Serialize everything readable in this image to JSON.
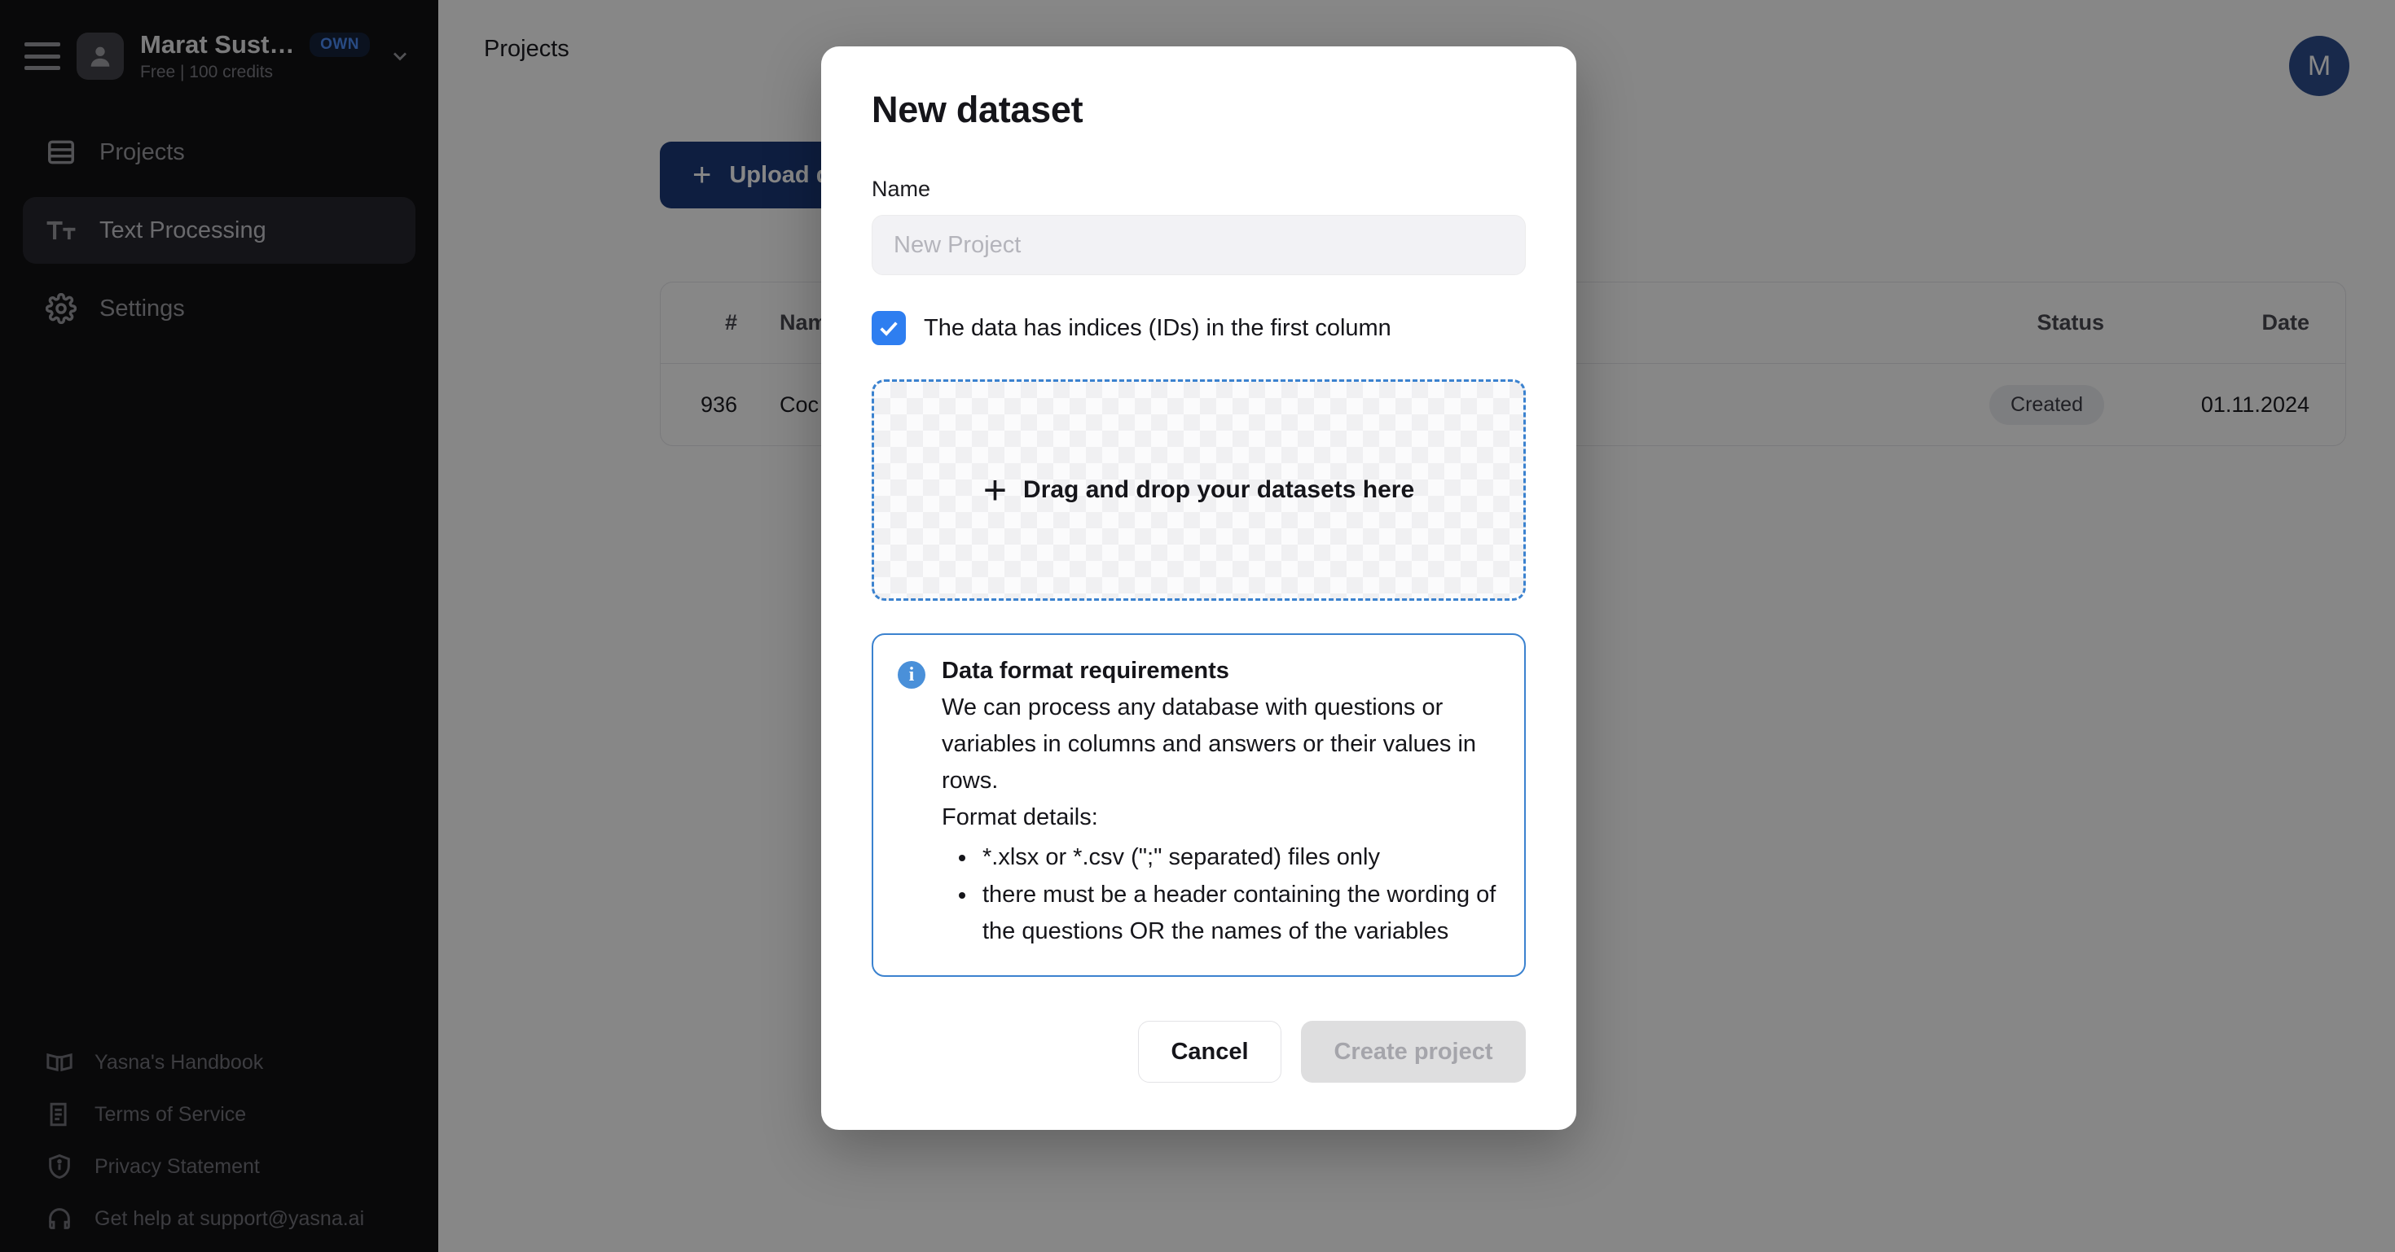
{
  "sidebar": {
    "account": {
      "name": "Marat Sustav...",
      "badge": "OWN",
      "subtitle": "Free | 100 credits",
      "menu_icon": "hamburger-icon",
      "avatar_icon": "person-icon",
      "chevron_icon": "chevron-down-icon"
    },
    "nav": [
      {
        "label": "Projects",
        "icon": "table-rows-icon",
        "active": false
      },
      {
        "label": "Text Processing",
        "icon": "text-format-icon",
        "active": true
      },
      {
        "label": "Settings",
        "icon": "gear-icon",
        "active": false
      }
    ],
    "links": [
      {
        "label": "Yasna's Handbook",
        "icon": "book-icon"
      },
      {
        "label": "Terms of Service",
        "icon": "document-icon"
      },
      {
        "label": "Privacy Statement",
        "icon": "shield-info-icon"
      },
      {
        "label": "Get help at support@yasna.ai",
        "icon": "headset-icon"
      }
    ]
  },
  "page": {
    "breadcrumb": "Projects",
    "avatar_initial": "M",
    "upload_button": "Upload d",
    "upload_plus": "+",
    "table": {
      "columns": [
        "#",
        "Nam",
        "Status",
        "Date"
      ],
      "rows": [
        {
          "num": "936",
          "name": "Coc",
          "status": "Created",
          "date": "01.11.2024"
        }
      ]
    }
  },
  "modal": {
    "title": "New dataset",
    "name_label": "Name",
    "name_value": "",
    "name_placeholder": "New Project",
    "checkbox": {
      "label": "The data has indices (IDs) in the first column",
      "checked": true,
      "icon": "check-icon"
    },
    "dropzone": {
      "plus": "+",
      "text": "Drag and drop your datasets here",
      "icon": "plus-icon"
    },
    "info": {
      "icon": "info-icon",
      "glyph": "i",
      "title": "Data format requirements",
      "paragraph": "We can process any database with questions or variables in columns and answers or their values in rows.",
      "details_label": "Format details:",
      "bullets": [
        "*.xlsx or *.csv (\";\" separated) files only",
        "there must be a header containing the wording of the questions OR the names of the variables"
      ]
    },
    "cancel_label": "Cancel",
    "create_label": "Create project"
  },
  "colors": {
    "sidebar_bg": "#111113",
    "accent_blue": "#2e7ef0",
    "primary_button": "#1b3a7a",
    "dropzone_border": "#3b82cf",
    "avatar_circle": "#2f4e8f"
  }
}
